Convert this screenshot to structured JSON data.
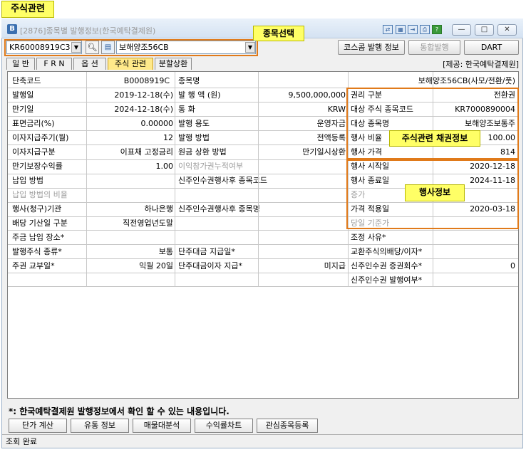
{
  "annotations": {
    "top_label": "주식관련",
    "item_select": "종목선택",
    "bond_info": "주식관련 채권정보",
    "exercise_info": "행사정보"
  },
  "window": {
    "title": "[2876]종목별 발행정보(한국예탁결제원)",
    "controls": [
      "—",
      "□",
      "✕"
    ]
  },
  "toolbar": {
    "code_value": "KR60008919C3",
    "name_value": "보해양조56CB",
    "koscom_button": "코스콤 발행 정보",
    "integrated_button": "통합발행",
    "dart_button": "DART"
  },
  "tabs": [
    "일 반",
    "F R N",
    "옵 션",
    "주식 관련",
    "분할상환"
  ],
  "active_tab": 3,
  "provider": "[제공: 한국예탁결제원]",
  "header_row": {
    "short_code_label": "단축코드",
    "short_code": "B0008919C",
    "name_label": "종목명",
    "name": "보해양조56CB(사모/전환/풋)"
  },
  "left": [
    {
      "label": "발행일",
      "value": "2019-12-18(수)"
    },
    {
      "label": "만기일",
      "value": "2024-12-18(수)"
    },
    {
      "label": "표면금리(%)",
      "value": "0.00000"
    },
    {
      "label": "이자지급주기(월)",
      "value": "12"
    },
    {
      "label": "이자지급구분",
      "value": "이표채 고정금리"
    }
  ],
  "mid": [
    {
      "label": "발 행 액 (원)",
      "value": "9,500,000,000"
    },
    {
      "label": "통   화",
      "value": "KRW"
    },
    {
      "label": "발행 용도",
      "value": "운영자금"
    },
    {
      "label": "발행 방법",
      "value": "전액등록"
    },
    {
      "label": "원금 상환 방법",
      "value": "만기일시상환"
    }
  ],
  "bond_info": [
    {
      "label": "권리 구분",
      "value": "전환권"
    },
    {
      "label": "대상 주식 종목코드",
      "value": "KR7000890004"
    },
    {
      "label": "대상 종목명",
      "value": "보해양조보통주"
    },
    {
      "label": "행사 비율",
      "value": "100.00"
    },
    {
      "label": "행사 가격",
      "value": "814"
    }
  ],
  "left2": [
    {
      "label": "만기보장수익률",
      "value": "1.00"
    },
    {
      "label": "납입 방법",
      "value": ""
    },
    {
      "label": "납입 방법의 비율",
      "value": ""
    },
    {
      "label": "행사(청구)기관",
      "value": "하나은행"
    },
    {
      "label": "배당 기산일 구분",
      "value": "직전영업년도말"
    }
  ],
  "mid2": [
    {
      "label": "이익참가권누적여부",
      "value": ""
    },
    {
      "label": "신주인수권행사후 종목코드",
      "value": ""
    },
    {
      "label": "",
      "value": ""
    },
    {
      "label": "신주인수권행사후 종목명",
      "value": ""
    },
    {
      "label": "",
      "value": ""
    }
  ],
  "exercise": [
    {
      "label": "행사 시작일",
      "value": "2020-12-18"
    },
    {
      "label": "행사 종료일",
      "value": "2024-11-18"
    },
    {
      "label": "증가",
      "value": ""
    },
    {
      "label": "가격 적용일",
      "value": "2020-03-18"
    },
    {
      "label": "당일 기준가",
      "value": ""
    }
  ],
  "left3": [
    {
      "label": "주금 납입 장소*",
      "value": ""
    },
    {
      "label": "발행주식 종류*",
      "value": "보통"
    },
    {
      "label": "주권 교부일*",
      "value": "익월 20일"
    }
  ],
  "mid3": [
    {
      "label": "",
      "value": ""
    },
    {
      "label": "단주대금 지급일*",
      "value": ""
    },
    {
      "label": "단주대금이자 지급*",
      "value": "미지급"
    }
  ],
  "right3": [
    {
      "label": "조정 사유*",
      "value": ""
    },
    {
      "label": "교환주식의배당/이자*",
      "value": ""
    },
    {
      "label": "신주인수권 증권회수*",
      "value": "0"
    },
    {
      "label": "신주인수권 발행여부*",
      "value": ""
    }
  ],
  "footnote": "*: 한국예탁결제원 발행정보에서 확인 할 수 있는 내용입니다.",
  "footer_buttons": [
    "단가 계산",
    "유통 정보",
    "매물대분석",
    "수익률차트",
    "관심종목등록"
  ],
  "status": "조회 완료",
  "colors": {
    "annotation_fill": "#ffff66",
    "annotation_border": "#e07a1a",
    "active_tab": "#ffe98a"
  }
}
